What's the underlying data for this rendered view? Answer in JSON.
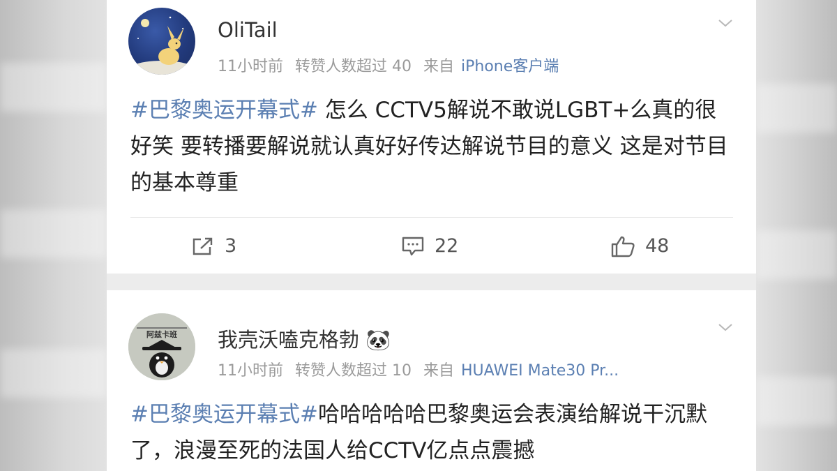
{
  "posts": [
    {
      "username": "OliTail",
      "time": "11小时前",
      "reposts_note": "转赞人数超过 40",
      "from_label": "来自",
      "source": "iPhone客户端",
      "hashtag": "#巴黎奥运开幕式#",
      "body": " 怎么 CCTV5解说不敢说LGBT+么真的很好笑 要转播要解说就认真好好传达解说节目的意义 这是对节目的基本尊重",
      "share_count": "3",
      "comment_count": "22",
      "like_count": "48",
      "avatar_icon": "rabbit-moon-avatar"
    },
    {
      "username": "我壳沃嗑克格勃 🐼",
      "time": "11小时前",
      "reposts_note": "转赞人数超过 10",
      "from_label": "来自",
      "source": "HUAWEI Mate30 Pr...",
      "hashtag": "#巴黎奥运开幕式#",
      "body": "哈哈哈哈哈巴黎奥运会表演给解说干沉默了，浪漫至死的法国人给CCTV亿点点震撼",
      "avatar_text": "阿兹卡班",
      "avatar_icon": "penguin-hat-avatar"
    }
  ],
  "colors": {
    "link": "#5b7fb2",
    "meta": "#9a9a9a",
    "text": "#222222"
  }
}
